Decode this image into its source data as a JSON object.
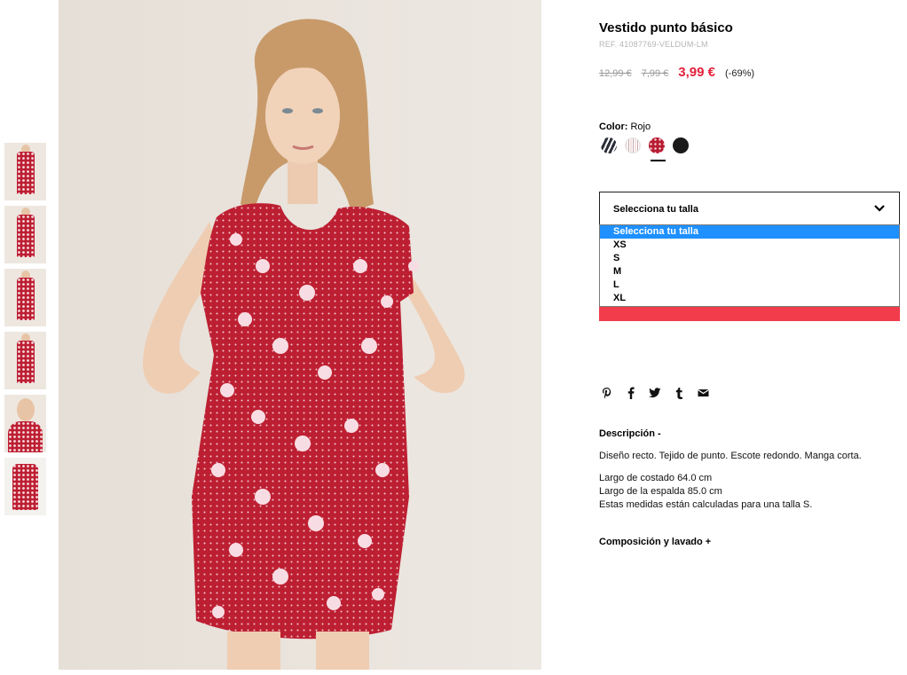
{
  "thumbnails": [
    "thumb-front-full",
    "thumb-side-full",
    "thumb-back-full",
    "thumb-front-posed",
    "thumb-closeup",
    "thumb-product-flat"
  ],
  "product": {
    "title": "Vestido punto básico",
    "ref": "REF. 41087769-VELDUM-LM",
    "price_original": "12,99 €",
    "price_previous": "7,99 €",
    "price_sale": "3,99 €",
    "discount": "(-69%)"
  },
  "color": {
    "label": "Color:",
    "value": "Rojo",
    "swatches": [
      "stripe-dark",
      "stripe-light",
      "red-dots",
      "black"
    ],
    "selected_index": 2
  },
  "size": {
    "placeholder": "Selecciona tu talla",
    "options": [
      "Selecciona tu talla",
      "XS",
      "S",
      "M",
      "L",
      "XL"
    ],
    "selected_index": 0
  },
  "social": [
    "pinterest-icon",
    "facebook-icon",
    "twitter-icon",
    "tumblr-icon",
    "email-icon"
  ],
  "description": {
    "title": "Descripción -",
    "text": "Diseño recto. Tejido de punto. Escote redondo. Manga corta.",
    "measures": [
      "Largo de costado 64.0 cm",
      "Largo de la espalda 85.0 cm",
      "Estas medidas están calculadas para una talla S."
    ]
  },
  "composition": {
    "title": "Composición y lavado +"
  },
  "colors": {
    "sale": "#e3213a",
    "add_bar": "#f23c4b",
    "dropdown_highlight": "#1e90ff",
    "dress": "#bd1f32"
  }
}
